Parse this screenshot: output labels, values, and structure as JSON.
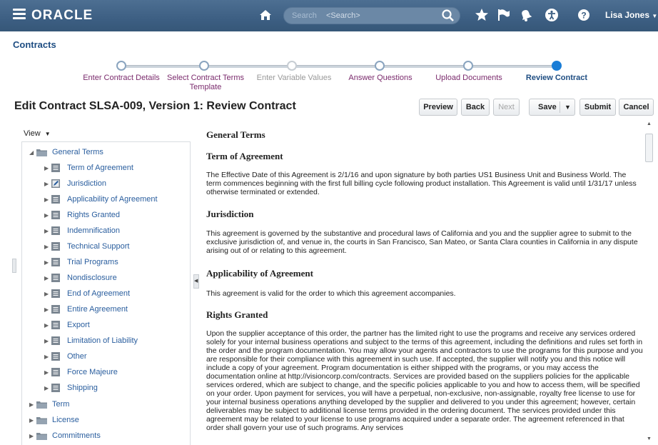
{
  "header": {
    "logo": "ORACLE",
    "search_label": "Search",
    "search_placeholder": "<Search>",
    "user": "Lisa Jones"
  },
  "app_title": "Contracts",
  "train": {
    "steps": [
      {
        "label": "Enter Contract Details",
        "state": "visited"
      },
      {
        "label": "Select Contract Terms",
        "label2": "Template",
        "state": "visited"
      },
      {
        "label": "Enter Variable Values",
        "state": "disabled"
      },
      {
        "label": "Answer Questions",
        "state": "visited"
      },
      {
        "label": "Upload Documents",
        "state": "visited"
      },
      {
        "label": "Review Contract",
        "state": "active"
      }
    ]
  },
  "page_heading": "Edit Contract SLSA-009, Version 1: Review Contract",
  "buttons": {
    "preview": "Preview",
    "back": "Back",
    "next": "Next",
    "save": "Save",
    "submit": "Submit",
    "cancel": "Cancel"
  },
  "view_menu": "View",
  "tree": {
    "general_terms": "General Terms",
    "children": [
      {
        "label": "Term of Agreement",
        "icon": "document-icon"
      },
      {
        "label": "Jurisdiction",
        "icon": "edit-document-icon"
      },
      {
        "label": "Applicability of Agreement",
        "icon": "document-icon"
      },
      {
        "label": "Rights Granted",
        "icon": "document-icon"
      },
      {
        "label": "Indemnification",
        "icon": "document-icon"
      },
      {
        "label": "Technical Support",
        "icon": "document-icon"
      },
      {
        "label": "Trial Programs",
        "icon": "document-icon"
      },
      {
        "label": "Nondisclosure",
        "icon": "document-icon"
      },
      {
        "label": "End of Agreement",
        "icon": "document-icon"
      },
      {
        "label": "Entire Agreement",
        "icon": "document-icon"
      },
      {
        "label": "Export",
        "icon": "document-icon"
      },
      {
        "label": "Limitation of Liability",
        "icon": "document-icon"
      },
      {
        "label": "Other",
        "icon": "document-icon"
      },
      {
        "label": "Force Majeure",
        "icon": "document-icon"
      },
      {
        "label": "Shipping",
        "icon": "document-icon"
      }
    ],
    "siblings": [
      "Term",
      "License",
      "Commitments"
    ]
  },
  "content": {
    "section_title": "General Terms",
    "term_title": "Term of Agreement",
    "term_text": "The Effective Date of this Agreement is 2/1/16 and upon signature by both parties US1 Business Unit and Business World. The term commences beginning with the first full billing cycle following product installation. This Agreement is valid until 1/31/17 unless otherwise terminated or extended.",
    "jur_title": "Jurisdiction",
    "jur_text": "This agreement is governed by the substantive and procedural laws of California and you and the supplier agree to submit to the exclusive jurisdiction of, and venue in, the courts in San Francisco, San Mateo, or Santa Clara counties in California in any dispute arising out of or relating to this agreement.",
    "app_title": "Applicability of Agreement",
    "app_text": "This agreement is valid for the order to which this agreement accompanies.",
    "rights_title": "Rights Granted",
    "rights_text": "Upon the supplier acceptance of this order, the partner has the limited right to use the programs and receive any services ordered solely for your internal business operations and subject to the terms of this agreement, including the definitions and rules set forth in the order and the program documentation. You may allow your agents and contractors to use the programs for this purpose and you are responsible for their compliance with this agreement in such use. If accepted, the supplier will notify you and this notice will include a copy of your agreement. Program documentation is either shipped with the programs, or you may access the documentation online at http://visioncorp.com/contracts. Services are provided based on the suppliers policies for the applicable services ordered, which are subject to change, and the specific policies applicable to you and how to access them, will be specified on your order. Upon payment for services, you will have a perpetual, non-exclusive, non-assignable, royalty free license to use for your internal business operations anything developed by the supplier and delivered to you under this agreement; however, certain deliverables may be subject to additional license terms provided in the ordering document. The services provided under this agreement may be related to your license to use programs acquired under a separate order. The agreement referenced in that order shall govern your use of such programs. Any services"
  }
}
